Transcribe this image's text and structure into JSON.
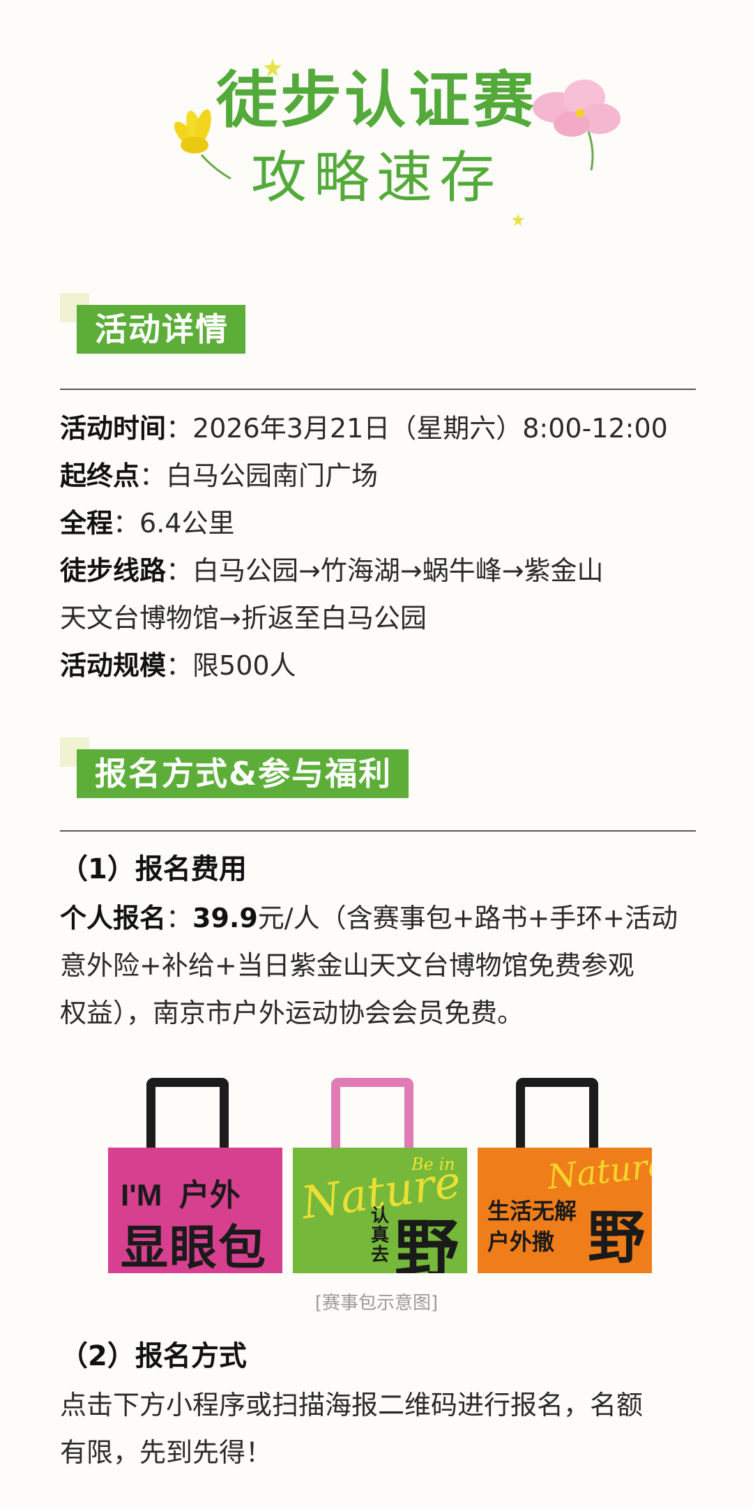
{
  "header": {
    "title_line1": "徒步认证赛",
    "title_line2": "攻略速存"
  },
  "sections": {
    "details": {
      "heading": "活动详情",
      "time_label": "活动时间",
      "time_value": "：2026年3月21日（星期六）8:00-12:00",
      "start_label": "起终点",
      "start_value": "：白马公园南门广场",
      "distance_label": "全程",
      "distance_value": "：6.4公里",
      "route_label": "徒步线路",
      "route_value": "：白马公园→竹海湖→蜗牛峰→紫金山",
      "route_value_2": "天文台博物馆→折返至白马公园",
      "scale_label": "活动规模",
      "scale_value": "：限500人"
    },
    "signup": {
      "heading": "报名方式&参与福利",
      "fee_title": "（1）报名费用",
      "fee_label": "个人报名",
      "fee_colon": "：",
      "fee_price": "39.9",
      "fee_unit": "元/人（含赛事包+路书+手环+活动",
      "fee_line2": "意外险+补给+当日紫金山天文台博物馆免费参观",
      "fee_line3": "权益），南京市户外运动协会会员免费。",
      "method_title": "（2）报名方式",
      "method_line1": "点击下方小程序或扫描海报二维码进行报名，名额",
      "method_line2": "有限，先到先得！"
    }
  },
  "bags": [
    {
      "color": "#d7408f",
      "handle_color": "#1c1c1c",
      "text_top": "I'M  户外",
      "text_main": "显眼包"
    },
    {
      "color": "#75b83a",
      "handle_color": "#e07bb5",
      "script_text": "Nature",
      "script_small": "Be in",
      "text_side": "认真去",
      "text_main": "野"
    },
    {
      "color": "#ef7d1a",
      "handle_color": "#1c1c1c",
      "script_text": "Nature",
      "text_top": "生活无解",
      "text_bottom": "户外撒",
      "text_main": "野"
    }
  ],
  "caption": "[赛事包示意图]",
  "colors": {
    "accent_green": "#5cae39",
    "title_green": "#53a93a",
    "flower_pink": "#f5b6cf",
    "flower_yellow": "#f3d51d"
  }
}
